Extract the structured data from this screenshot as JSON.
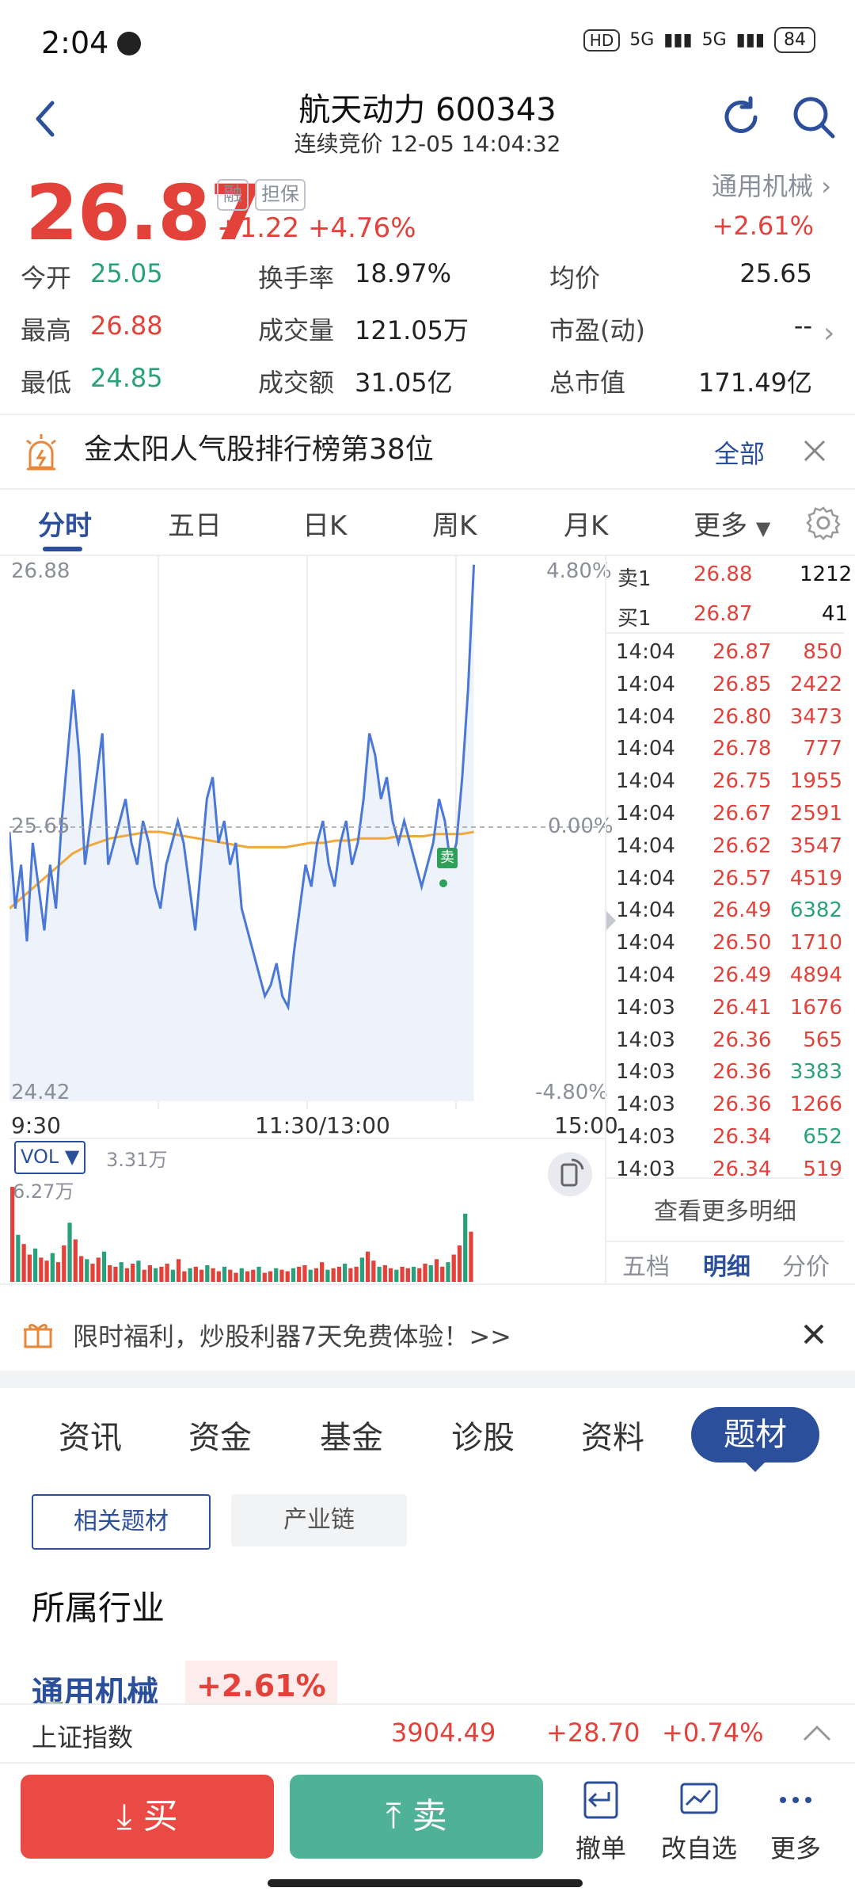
{
  "status": {
    "time": "2:04",
    "network1": "HD",
    "sig1": "5G",
    "sig2": "5G",
    "battery": "84"
  },
  "header": {
    "title": "航天动力 600343",
    "subtitle": "连续竞价 12-05 14:04:32"
  },
  "quote": {
    "price": "26.87",
    "tag1": "融",
    "tag2": "担保",
    "change": "+1.22 +4.76%",
    "industry": "通用机械",
    "industry_change": "+2.61%",
    "stats": [
      {
        "label": "今开",
        "value": "25.05",
        "color": "#28a17c"
      },
      {
        "label": "换手率",
        "value": "18.97%",
        "color": "#222222"
      },
      {
        "label": "均价",
        "value": "25.65",
        "color": "#222222"
      },
      {
        "label": "最高",
        "value": "26.88",
        "color": "#e3423b"
      },
      {
        "label": "成交量",
        "value": "121.05万",
        "color": "#222222"
      },
      {
        "label": "市盈(动)",
        "value": "--",
        "color": "#222222"
      },
      {
        "label": "最低",
        "value": "24.85",
        "color": "#28a17c"
      },
      {
        "label": "成交额",
        "value": "31.05亿",
        "color": "#222222"
      },
      {
        "label": "总市值",
        "value": "171.49亿",
        "color": "#222222"
      }
    ]
  },
  "banner": {
    "text": "金太阳人气股排行榜第38位",
    "action": "全部"
  },
  "ktabs": [
    "分时",
    "五日",
    "日K",
    "周K",
    "月K",
    "更多"
  ],
  "chart": {
    "y_high": "26.88",
    "y_mid": "25.65",
    "y_low": "24.42",
    "pct_high": "4.80%",
    "pct_mid": "0.00%",
    "pct_low": "-4.80%",
    "x_start": "9:30",
    "x_mid": "11:30/13:00",
    "x_end": "15:00",
    "sell_marker": "卖",
    "vol_label": "VOL ▼",
    "vol_value": "3.31万",
    "vol_max": "6.27万"
  },
  "chart_data": {
    "type": "line",
    "ylim": [
      24.42,
      26.88
    ],
    "price": [
      25.65,
      25.3,
      25.5,
      25.15,
      25.6,
      25.4,
      25.2,
      25.5,
      25.3,
      25.7,
      26.0,
      26.3,
      26.0,
      25.5,
      25.7,
      25.9,
      26.1,
      25.5,
      25.6,
      25.7,
      25.8,
      25.6,
      25.5,
      25.7,
      25.6,
      25.4,
      25.3,
      25.5,
      25.6,
      25.7,
      25.6,
      25.4,
      25.2,
      25.5,
      25.8,
      25.9,
      25.6,
      25.7,
      25.5,
      25.6,
      25.3,
      25.2,
      25.1,
      25.0,
      24.9,
      24.95,
      25.05,
      24.9,
      24.85,
      25.1,
      25.3,
      25.5,
      25.4,
      25.6,
      25.7,
      25.5,
      25.4,
      25.6,
      25.7,
      25.5,
      25.6,
      25.8,
      26.1,
      26.0,
      25.8,
      25.9,
      25.7,
      25.6,
      25.7,
      25.6,
      25.5,
      25.4,
      25.5,
      25.6,
      25.8,
      25.7,
      25.5,
      25.6,
      25.9,
      26.3,
      26.87
    ],
    "avg": [
      25.3,
      25.35,
      25.4,
      25.45,
      25.5,
      25.55,
      25.58,
      25.6,
      25.62,
      25.63,
      25.64,
      25.65,
      25.65,
      25.64,
      25.63,
      25.62,
      25.61,
      25.6,
      25.59,
      25.58,
      25.58,
      25.58,
      25.58,
      25.59,
      25.6,
      25.6,
      25.61,
      25.61,
      25.62,
      25.62,
      25.62,
      25.63,
      25.63,
      25.63,
      25.64,
      25.64,
      25.64,
      25.65
    ],
    "volume": [
      6.27,
      3.1,
      2.5,
      1.8,
      2.2,
      1.6,
      1.4,
      1.9,
      1.3,
      2.4,
      3.9,
      2.8,
      1.7,
      1.5,
      1.2,
      1.6,
      2.0,
      1.1,
      1.0,
      1.3,
      0.9,
      1.2,
      1.4,
      0.8,
      1.1,
      0.9,
      1.0,
      1.2,
      0.8,
      1.5,
      0.7,
      0.9,
      1.0,
      0.8,
      1.1,
      0.9,
      0.7,
      1.0,
      0.8,
      0.6,
      0.9,
      0.7,
      0.8,
      1.0,
      0.6,
      0.7,
      0.9,
      0.8,
      0.7,
      0.9,
      1.0,
      1.1,
      0.8,
      0.9,
      1.3,
      0.8,
      0.9,
      1.0,
      1.2,
      0.9,
      1.0,
      1.6,
      2.0,
      1.4,
      1.0,
      1.1,
      0.9,
      0.8,
      1.0,
      0.9,
      1.0,
      0.9,
      1.2,
      1.1,
      1.5,
      1.0,
      1.3,
      1.8,
      2.4,
      4.5,
      3.31
    ]
  },
  "orderbook": {
    "ask_label": "卖1",
    "ask_price": "26.88",
    "ask_vol": "1212",
    "bid_label": "买1",
    "bid_price": "26.87",
    "bid_vol": "41"
  },
  "trades": [
    {
      "t": "14:04",
      "p": "26.87",
      "v": "850",
      "c": "#e3423b"
    },
    {
      "t": "14:04",
      "p": "26.85",
      "v": "2422",
      "c": "#e3423b"
    },
    {
      "t": "14:04",
      "p": "26.80",
      "v": "3473",
      "c": "#e3423b"
    },
    {
      "t": "14:04",
      "p": "26.78",
      "v": "777",
      "c": "#e3423b"
    },
    {
      "t": "14:04",
      "p": "26.75",
      "v": "1955",
      "c": "#e3423b"
    },
    {
      "t": "14:04",
      "p": "26.67",
      "v": "2591",
      "c": "#e3423b"
    },
    {
      "t": "14:04",
      "p": "26.62",
      "v": "3547",
      "c": "#e3423b"
    },
    {
      "t": "14:04",
      "p": "26.57",
      "v": "4519",
      "c": "#e3423b"
    },
    {
      "t": "14:04",
      "p": "26.49",
      "v": "6382",
      "c": "#28a17c"
    },
    {
      "t": "14:04",
      "p": "26.50",
      "v": "1710",
      "c": "#e3423b"
    },
    {
      "t": "14:04",
      "p": "26.49",
      "v": "4894",
      "c": "#e3423b"
    },
    {
      "t": "14:03",
      "p": "26.41",
      "v": "1676",
      "c": "#e3423b"
    },
    {
      "t": "14:03",
      "p": "26.36",
      "v": "565",
      "c": "#e3423b"
    },
    {
      "t": "14:03",
      "p": "26.36",
      "v": "3383",
      "c": "#28a17c"
    },
    {
      "t": "14:03",
      "p": "26.36",
      "v": "1266",
      "c": "#e3423b"
    },
    {
      "t": "14:03",
      "p": "26.34",
      "v": "652",
      "c": "#28a17c"
    },
    {
      "t": "14:03",
      "p": "26.34",
      "v": "519",
      "c": "#e3423b"
    }
  ],
  "trade_panel": {
    "more": "查看更多明细",
    "tabs": [
      "五档",
      "明细",
      "分价"
    ]
  },
  "promo": {
    "text": "限时福利，炒股利器7天免费体验！>>"
  },
  "info_tabs": [
    "资讯",
    "资金",
    "基金",
    "诊股",
    "资料",
    "题材"
  ],
  "chips": [
    "相关题材",
    "产业链"
  ],
  "section": {
    "title": "所属行业",
    "industry": "通用机械",
    "change": "+2.61%"
  },
  "index": {
    "name": "上证指数",
    "value": "3904.49",
    "change": "+28.70",
    "pct": "+0.74%"
  },
  "bottom": {
    "buy": "买",
    "sell": "卖",
    "items": [
      "撤单",
      "改自选",
      "更多"
    ]
  },
  "colors": {
    "up": "#e3423b",
    "down": "#28a17c",
    "accent": "#2c4f9c",
    "avg_line": "#f0a83a",
    "price_line": "#4a78d9"
  }
}
